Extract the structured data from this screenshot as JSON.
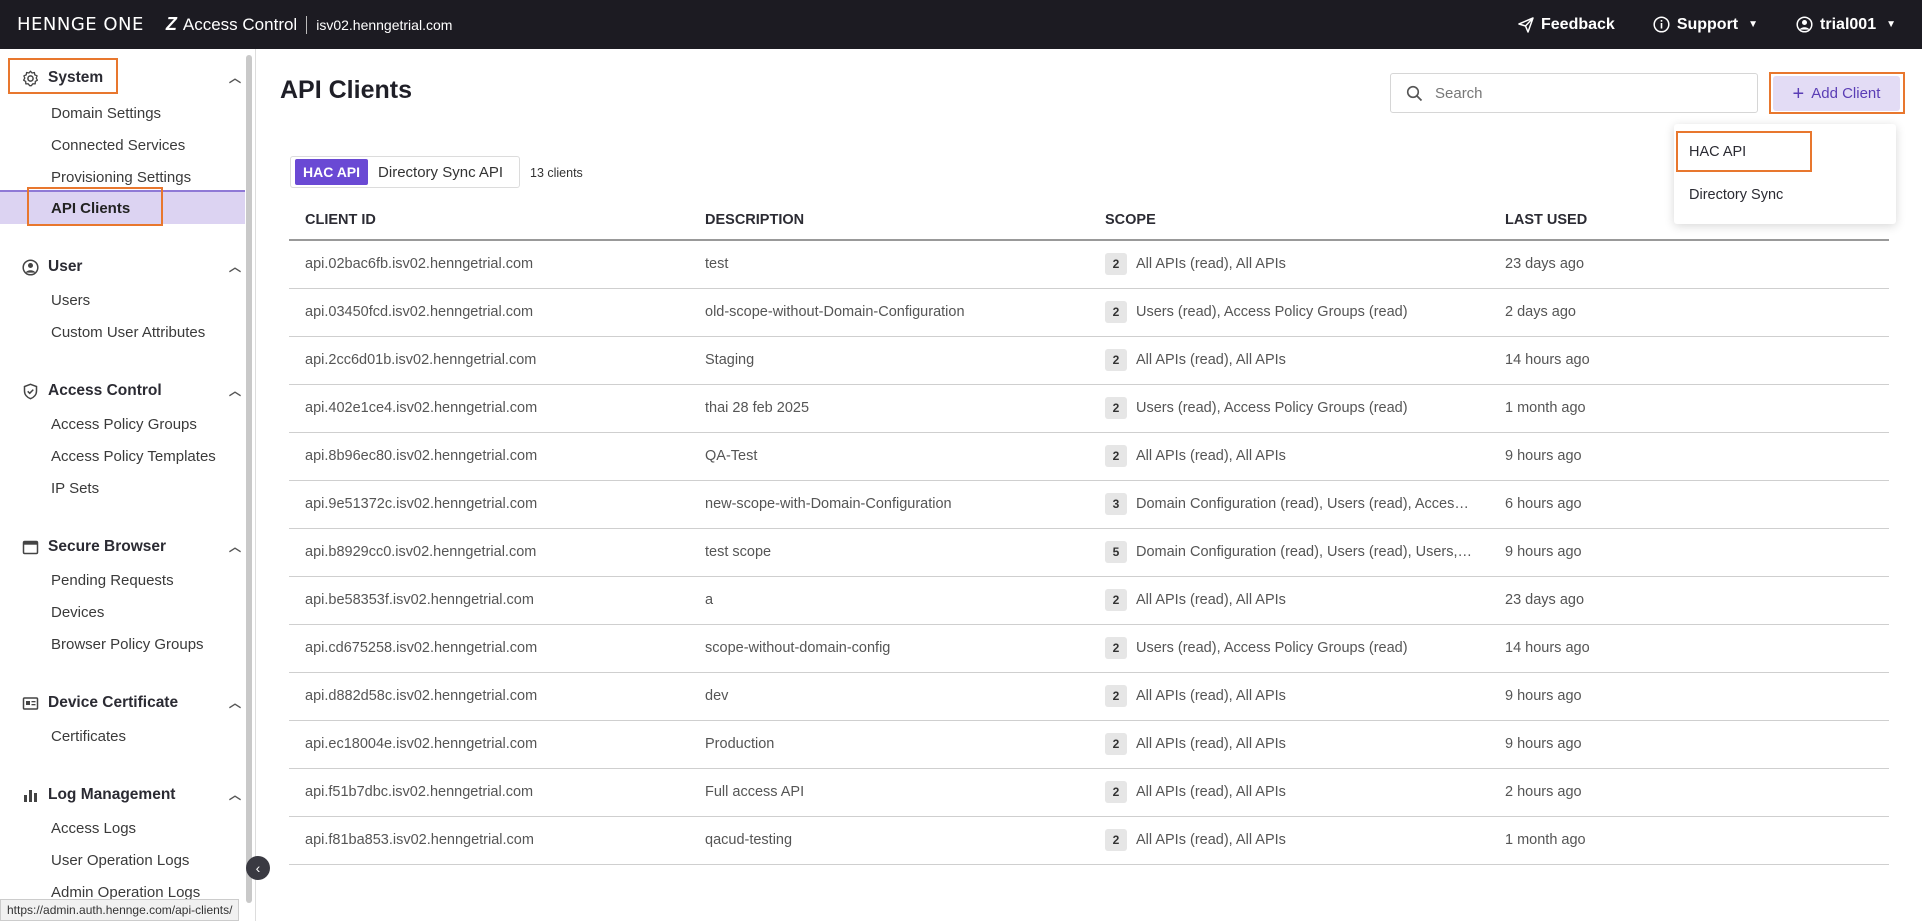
{
  "header": {
    "logo": "HENNGE ONE",
    "product": "Access Control",
    "domain": "isv02.henngetrial.com",
    "feedback": "Feedback",
    "support": "Support",
    "user": "trial001"
  },
  "sidebar": {
    "sections": [
      {
        "title": "System",
        "icon": "gear-icon",
        "items": [
          "Domain Settings",
          "Connected Services",
          "Provisioning Settings",
          "API Clients"
        ]
      },
      {
        "title": "User",
        "icon": "user-circle-icon",
        "items": [
          "Users",
          "Custom User Attributes"
        ]
      },
      {
        "title": "Access Control",
        "icon": "shield-icon",
        "items": [
          "Access Policy Groups",
          "Access Policy Templates",
          "IP Sets"
        ]
      },
      {
        "title": "Secure Browser",
        "icon": "browser-icon",
        "items": [
          "Pending Requests",
          "Devices",
          "Browser Policy Groups"
        ]
      },
      {
        "title": "Device Certificate",
        "icon": "certificate-icon",
        "items": [
          "Certificates"
        ]
      },
      {
        "title": "Log Management",
        "icon": "bar-chart-icon",
        "items": [
          "Access Logs",
          "User Operation Logs",
          "Admin Operation Logs"
        ]
      }
    ],
    "active_item": "API Clients"
  },
  "status_url": "https://admin.auth.hennge.com/api-clients/",
  "main": {
    "title": "API Clients",
    "search_placeholder": "Search",
    "add_button": "Add Client",
    "dropdown": [
      "HAC API",
      "Directory Sync"
    ],
    "tabs": [
      "HAC API",
      "Directory Sync API"
    ],
    "client_count": "13 clients",
    "columns": [
      "CLIENT ID",
      "DESCRIPTION",
      "SCOPE",
      "LAST USED"
    ],
    "rows": [
      {
        "id": "api.02bac6fb.isv02.henngetrial.com",
        "desc": "test",
        "count": "2",
        "scope": "All APIs (read), All APIs",
        "last": "23 days ago"
      },
      {
        "id": "api.03450fcd.isv02.henngetrial.com",
        "desc": "old-scope-without-Domain-Configuration",
        "count": "2",
        "scope": "Users (read), Access Policy Groups (read)",
        "last": "2 days ago"
      },
      {
        "id": "api.2cc6d01b.isv02.henngetrial.com",
        "desc": "Staging",
        "count": "2",
        "scope": "All APIs (read), All APIs",
        "last": "14 hours ago"
      },
      {
        "id": "api.402e1ce4.isv02.henngetrial.com",
        "desc": "thai 28 feb 2025",
        "count": "2",
        "scope": "Users (read), Access Policy Groups (read)",
        "last": "1 month ago"
      },
      {
        "id": "api.8b96ec80.isv02.henngetrial.com",
        "desc": "QA-Test",
        "count": "2",
        "scope": "All APIs (read), All APIs",
        "last": "9 hours ago"
      },
      {
        "id": "api.9e51372c.isv02.henngetrial.com",
        "desc": "new-scope-with-Domain-Configuration",
        "count": "3",
        "scope": "Domain Configuration (read), Users (read), Access…",
        "last": "6 hours ago"
      },
      {
        "id": "api.b8929cc0.isv02.henngetrial.com",
        "desc": "test scope",
        "count": "5",
        "scope": "Domain Configuration (read), Users (read), Users, …",
        "last": "9 hours ago"
      },
      {
        "id": "api.be58353f.isv02.henngetrial.com",
        "desc": "a",
        "count": "2",
        "scope": "All APIs (read), All APIs",
        "last": "23 days ago"
      },
      {
        "id": "api.cd675258.isv02.henngetrial.com",
        "desc": "scope-without-domain-config",
        "count": "2",
        "scope": "Users (read), Access Policy Groups (read)",
        "last": "14 hours ago"
      },
      {
        "id": "api.d882d58c.isv02.henngetrial.com",
        "desc": "dev",
        "count": "2",
        "scope": "All APIs (read), All APIs",
        "last": "9 hours ago"
      },
      {
        "id": "api.ec18004e.isv02.henngetrial.com",
        "desc": "Production",
        "count": "2",
        "scope": "All APIs (read), All APIs",
        "last": "9 hours ago"
      },
      {
        "id": "api.f51b7dbc.isv02.henngetrial.com",
        "desc": "Full access API",
        "count": "2",
        "scope": "All APIs (read), All APIs",
        "last": "2 hours ago"
      },
      {
        "id": "api.f81ba853.isv02.henngetrial.com",
        "desc": "qacud-testing",
        "count": "2",
        "scope": "All APIs (read), All APIs",
        "last": "1 month ago"
      }
    ]
  },
  "colors": {
    "accent": "#6a49d4",
    "highlight": "#e8772e",
    "topbar": "#1c1b22",
    "active_nav": "#dcd3f2"
  }
}
